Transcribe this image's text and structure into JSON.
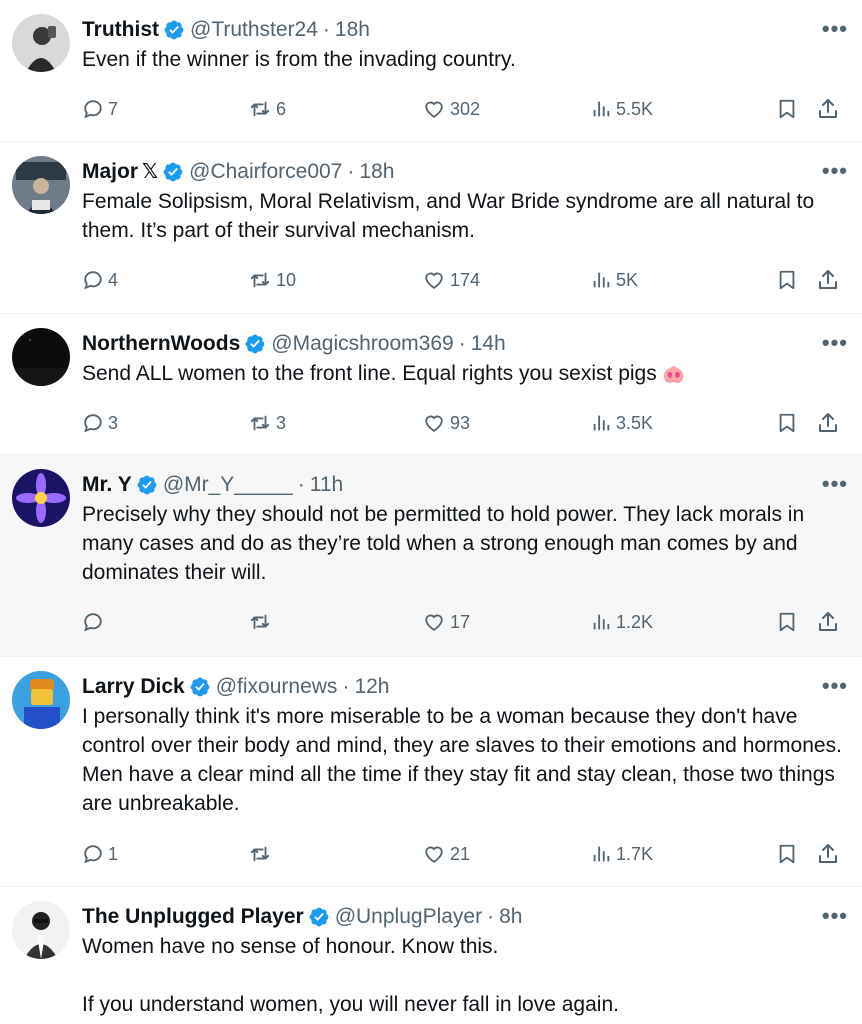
{
  "tweets": [
    {
      "name": "Truthist",
      "x_badge": "",
      "handle": "@Truthster24",
      "time": "18h",
      "text": "Even if the winner is from the invading country.",
      "replies": "7",
      "retweets": "6",
      "likes": "302",
      "views": "5.5K",
      "avatar_colors": [
        "#d9d9d9",
        "#3a3a3a"
      ]
    },
    {
      "name": "Major",
      "x_badge": "𝕏",
      "handle": "@Chairforce007",
      "time": "18h",
      "text": "Female Solipsism, Moral Relativism, and War Bride syndrome are all natural to them. It’s part of their survival mechanism.",
      "replies": "4",
      "retweets": "10",
      "likes": "174",
      "views": "5K",
      "avatar_colors": [
        "#6e7c8a",
        "#2d3945"
      ]
    },
    {
      "name": "NorthernWoods",
      "x_badge": "",
      "handle": "@Magicshroom369",
      "time": "14h",
      "text": "Send ALL women to the front line. Equal rights you sexist pigs ",
      "emoji": "🐽",
      "replies": "3",
      "retweets": "3",
      "likes": "93",
      "views": "3.5K",
      "avatar_colors": [
        "#0b0b0b",
        "#1a1a1a"
      ]
    },
    {
      "name": "Mr. Y",
      "x_badge": "",
      "handle": "@Mr_Y_____",
      "time": "11h",
      "text": "Precisely why they should not be permitted to hold power. They lack morals in many cases and do as they’re told when a strong enough man comes by and dominates their will.",
      "replies": "",
      "retweets": "",
      "likes": "17",
      "views": "1.2K",
      "avatar_colors": [
        "#1b1464",
        "#9b6bff"
      ]
    },
    {
      "name": "Larry Dick",
      "x_badge": "",
      "handle": "@fixournews",
      "time": "12h",
      "text": "I personally think it's more miserable to be a woman because they don't have control over their body and mind, they are slaves to their emotions and hormones. Men have a clear mind all the time if they stay fit and stay clean, those two things are unbreakable.",
      "replies": "1",
      "retweets": "",
      "likes": "21",
      "views": "1.7K",
      "avatar_colors": [
        "#3aa0e0",
        "#e08a1e"
      ]
    },
    {
      "name": "The Unplugged Player",
      "x_badge": "",
      "handle": "@UnplugPlayer",
      "time": "8h",
      "text": "Women have no sense of honour. Know this.\n\nIf you understand women, you will never fall in love again.",
      "avatar_colors": [
        "#f2f2f2",
        "#222222"
      ]
    }
  ],
  "more_label": "•••",
  "colors": {
    "verified": "#1d9bf0",
    "muted": "#536471",
    "text": "#0f1419"
  }
}
